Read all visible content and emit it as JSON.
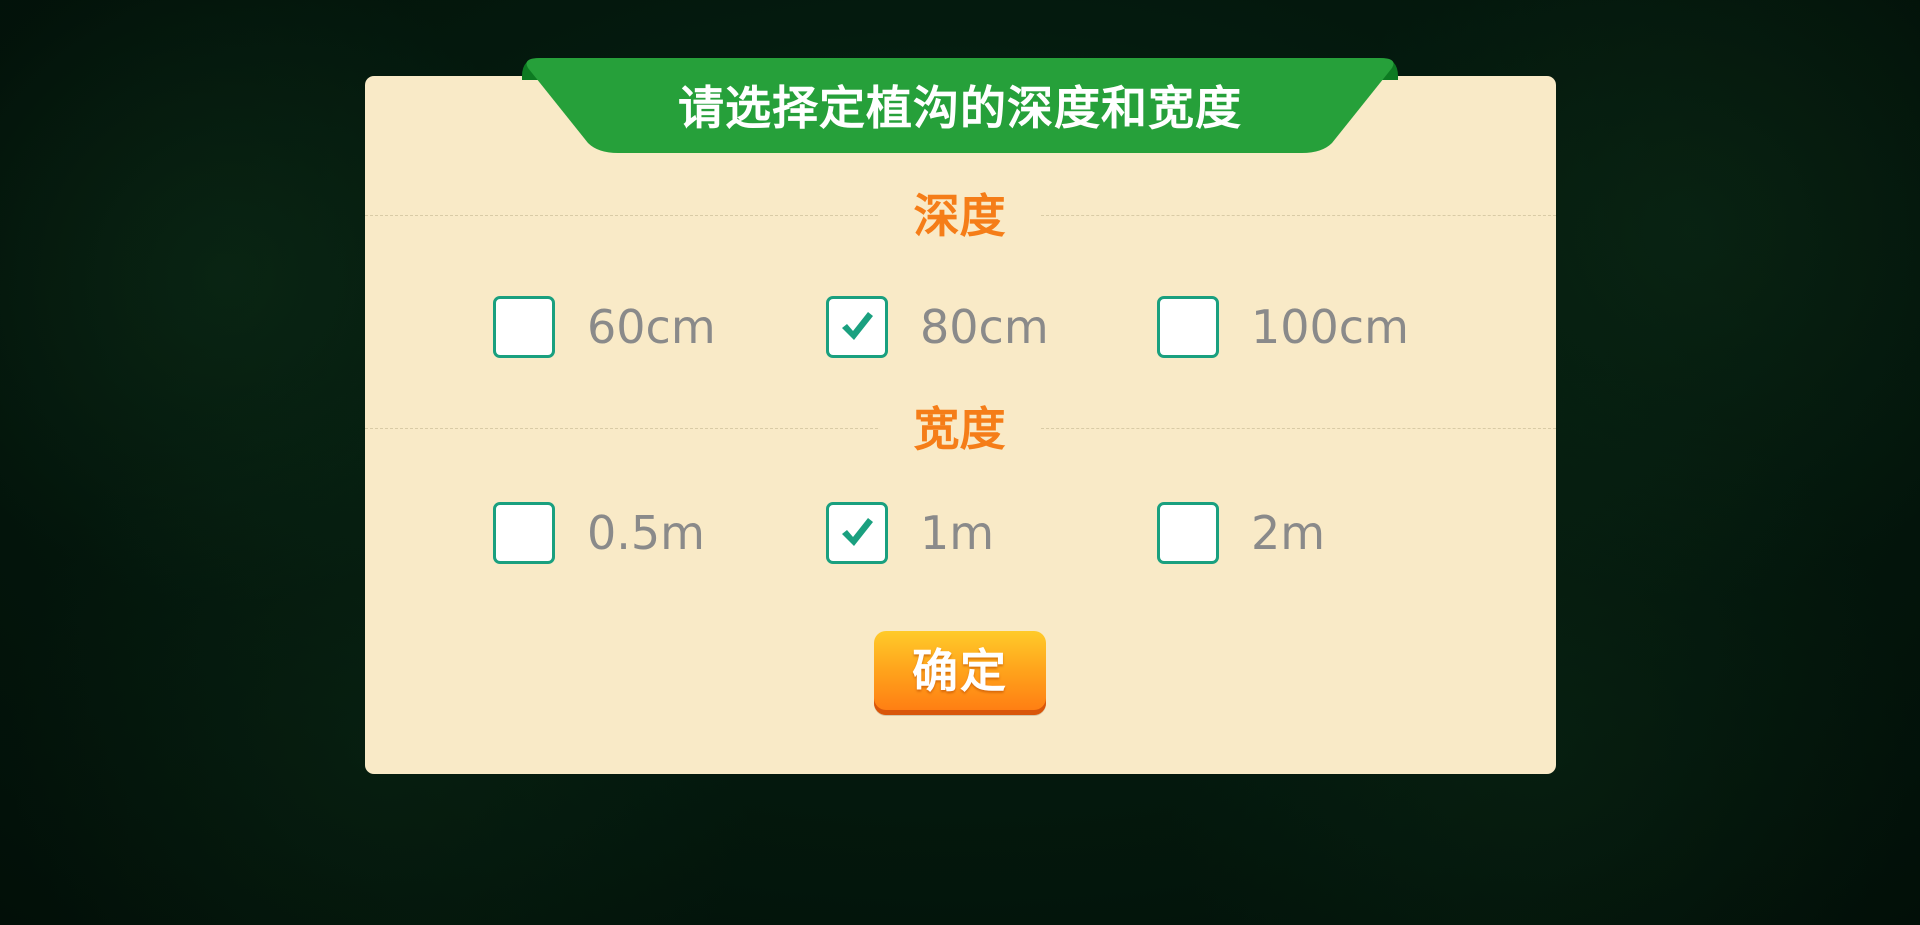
{
  "dialog": {
    "title": "请选择定植沟的深度和宽度",
    "depth": {
      "label": "深度",
      "options": [
        {
          "label": "60cm",
          "checked": false
        },
        {
          "label": "80cm",
          "checked": true
        },
        {
          "label": "100cm",
          "checked": false
        }
      ]
    },
    "width": {
      "label": "宽度",
      "options": [
        {
          "label": "0.5m",
          "checked": false
        },
        {
          "label": "1m",
          "checked": true
        },
        {
          "label": "2m",
          "checked": false
        }
      ]
    },
    "confirm_label": "确定"
  },
  "colors": {
    "ribbon": "#26a03a",
    "panel": "#f9eac7",
    "section_label": "#f57d18",
    "checkbox_border": "#1aa07f",
    "check_mark": "#1aa07f",
    "option_text": "#8a8a8a",
    "button": "#ffa51c"
  },
  "icons": {
    "checked": "check-icon"
  }
}
